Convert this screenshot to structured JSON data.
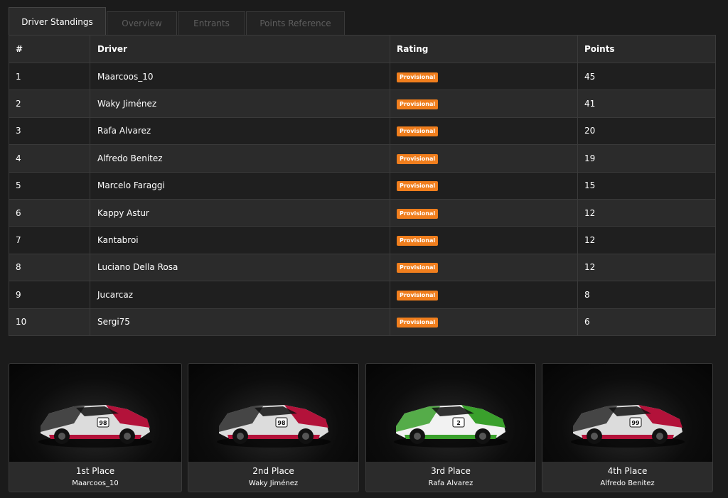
{
  "tabs": [
    {
      "label": "Driver Standings",
      "active": true
    },
    {
      "label": "Overview",
      "active": false
    },
    {
      "label": "Entrants",
      "active": false
    },
    {
      "label": "Points Reference",
      "active": false
    }
  ],
  "table": {
    "headers": {
      "pos": "#",
      "driver": "Driver",
      "rating": "Rating",
      "points": "Points"
    },
    "rows": [
      {
        "pos": "1",
        "driver": "Maarcoos_10",
        "rating": "Provisional",
        "points": "45"
      },
      {
        "pos": "2",
        "driver": "Waky Jiménez",
        "rating": "Provisional",
        "points": "41"
      },
      {
        "pos": "3",
        "driver": "Rafa Alvarez",
        "rating": "Provisional",
        "points": "20"
      },
      {
        "pos": "4",
        "driver": "Alfredo Benitez",
        "rating": "Provisional",
        "points": "19"
      },
      {
        "pos": "5",
        "driver": "Marcelo Faraggi",
        "rating": "Provisional",
        "points": "15"
      },
      {
        "pos": "6",
        "driver": "Kappy Astur",
        "rating": "Provisional",
        "points": "12"
      },
      {
        "pos": "7",
        "driver": "Kantabroi",
        "rating": "Provisional",
        "points": "12"
      },
      {
        "pos": "8",
        "driver": "Luciano Della Rosa",
        "rating": "Provisional",
        "points": "12"
      },
      {
        "pos": "9",
        "driver": "Jucarcaz",
        "rating": "Provisional",
        "points": "8"
      },
      {
        "pos": "10",
        "driver": "Sergi75",
        "rating": "Provisional",
        "points": "6"
      }
    ]
  },
  "podium": [
    {
      "place": "1st Place",
      "name": "Maarcoos_10",
      "livery": "red",
      "number": "98"
    },
    {
      "place": "2nd Place",
      "name": "Waky Jiménez",
      "livery": "red",
      "number": "98"
    },
    {
      "place": "3rd Place",
      "name": "Rafa Alvarez",
      "livery": "green",
      "number": "2"
    },
    {
      "place": "4th Place",
      "name": "Alfredo Benitez",
      "livery": "red",
      "number": "99"
    }
  ],
  "colors": {
    "badge": "#f07e1d",
    "livery_red": "#b3123a",
    "livery_green": "#3aa02c"
  },
  "icons": {
    "car": "race-car-image"
  }
}
